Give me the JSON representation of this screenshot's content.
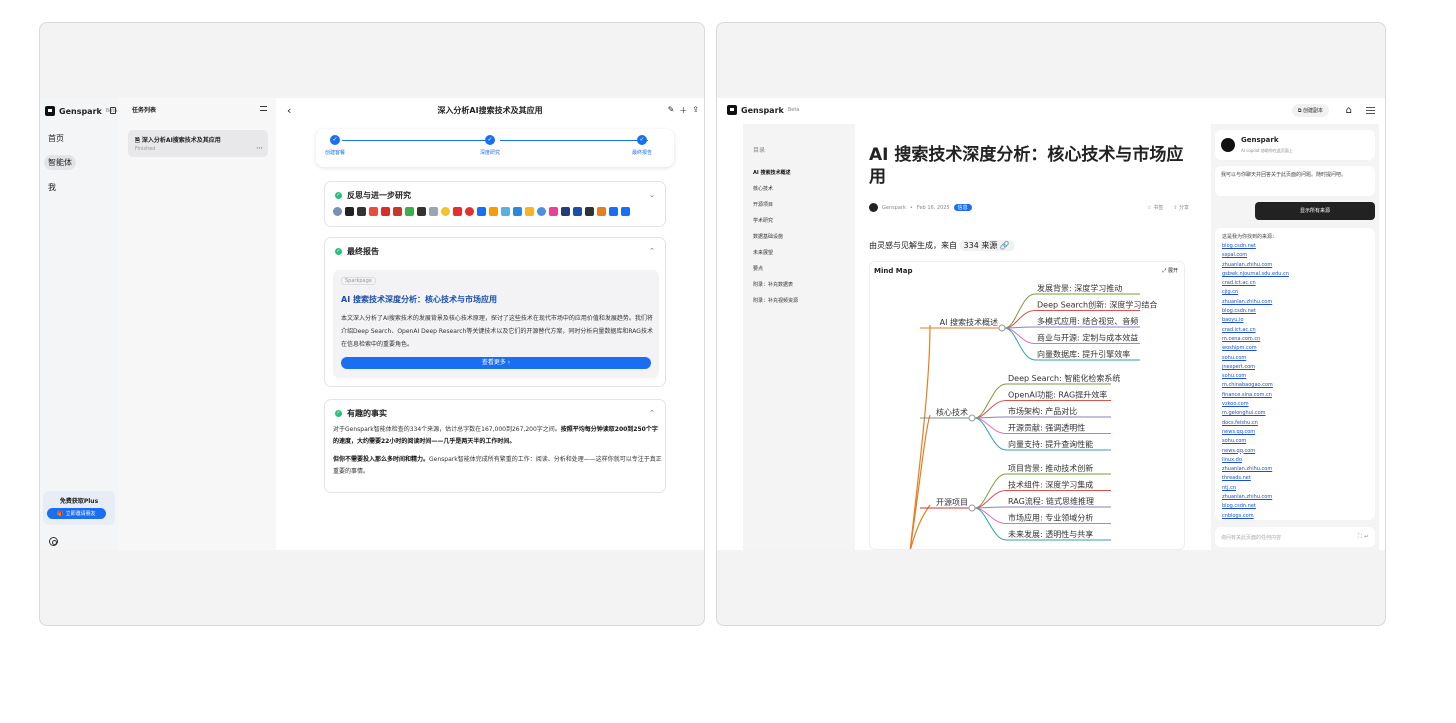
{
  "left": {
    "brand": {
      "name": "Genspark",
      "badge": "Beta"
    },
    "nav": [
      {
        "label": "首页"
      },
      {
        "label": "智能体"
      },
      {
        "label": "我"
      }
    ],
    "plus": {
      "title": "免费获取Plus",
      "button": "立即邀请朋友"
    },
    "tasks": {
      "title": "任务列表",
      "item": {
        "title": "深入分析AI搜索技术及其应用",
        "status": "Finished"
      }
    },
    "main": {
      "title": "深入分析AI搜索技术及其应用",
      "steps": [
        "创建客餐",
        "深度研究",
        "最终报告"
      ],
      "sections": {
        "reflect": "反思与进一步研究",
        "final": "最终报告",
        "facts": "有趣的事实"
      },
      "report": {
        "tag": "Sparkpage",
        "title": "AI 搜索技术深度分析：核心技术与市场应用",
        "body": "本文深入分析了AI搜索技术的发展背景及核心技术原理，探讨了这些技术在现代市场中的应用价值和发展趋势。我们将介绍Deep Search、OpenAI Deep Research等关键技术以及它们的开源替代方案，同时分析向量数据库和RAG技术在信息检索中的重要角色。",
        "more": "查看更多 ›"
      },
      "facts": {
        "p1_a": "对于Genspark智能体检查的334个来源，估计总字数在167,000到267,200字之间。",
        "p1_b": "按照平均每分钟读取200到250个字的速度，大约需要22小时的阅读时间——几乎是两天半的工作时间。",
        "p2_a": "但你不需要投入那么多时间和精力。",
        "p2_b": "Genspark智能体完成所有繁重的工作：阅读、分析和处理——这样你就可以专注于真正重要的事情。"
      }
    }
  },
  "right": {
    "brand": {
      "name": "Genspark",
      "badge": "Beta"
    },
    "copy_btn": "创建副本",
    "toc": {
      "title": "目录",
      "items": [
        "AI 搜索技术概述",
        "核心技术",
        "开源项目",
        "学术研究",
        "数据基础设施",
        "未来展望",
        "要点",
        "附录：补充数据表",
        "附录：补充视频资源"
      ]
    },
    "article": {
      "title": "AI 搜索技术深度分析：核心技术与市场应用",
      "author": "Genspark",
      "date": "Feb 16, 2025",
      "tag": "信息",
      "actions": [
        "书签",
        "分享"
      ],
      "gen_prefix": "由灵感与见解生成，来自",
      "source_count": "334 来源"
    },
    "mindmap": {
      "title": "Mind Map",
      "expand": "展开",
      "groups": [
        {
          "label": "AI 搜索技术概述",
          "items": [
            "发展背景: 深度学习推动",
            "Deep Search创新: 深度学习结合",
            "多模式应用: 结合视觉、音频",
            "商业与开源: 定制与成本效益",
            "向量数据库: 提升引擎效率"
          ]
        },
        {
          "label": "核心技术",
          "items": [
            "Deep Search: 智能化检索系统",
            "OpenAI功能: RAG提升效率",
            "市场架构: 产品对比",
            "开源贡献: 强调透明性",
            "向量支持: 提升查询性能"
          ]
        },
        {
          "label": "开源项目",
          "items": [
            "项目背景: 推动技术创新",
            "技术组件: 深度学习集成",
            "RAG流程: 链式思维推理",
            "市场应用: 专业领域分析",
            "未来发展: 透明性与共享"
          ]
        }
      ]
    },
    "chat": {
      "name": "Genspark",
      "subtitle": "AI copilot 协助你在此页面上",
      "message": "我可以与你聊天并回答关于此页面的问题。随时提问吧。",
      "show_sources": "显示所有来源",
      "sources_head": "这是我为你找到的来源：",
      "sources": [
        "blog.csdn.net",
        "sspai.com",
        "zhuanlan.zhihu.com",
        "gsbwk.njournal.sdu.edu.cn",
        "crad.ict.ac.cn",
        "cjig.cn",
        "zhuanlan.zhihu.com",
        "blog.csdn.net",
        "baoyu.io",
        "crad.ict.ac.cn",
        "m.cena.com.cn",
        "woshipm.com",
        "sohu.com",
        "jnexpert.com",
        "sohu.com",
        "m.chinabaogao.com",
        "finance.sina.com.cn",
        "vzkoo.com",
        "m.gelonghui.com",
        "docs.feishu.cn",
        "news.qq.com",
        "sohu.com",
        "news.qq.com",
        "linux.do",
        "zhuanlan.zhihu.com",
        "threads.net",
        "ntj.cn",
        "zhuanlan.zhihu.com",
        "blog.csdn.net",
        "cnblogs.com"
      ],
      "input_placeholder": "询问有关此页面的任何内容"
    }
  }
}
